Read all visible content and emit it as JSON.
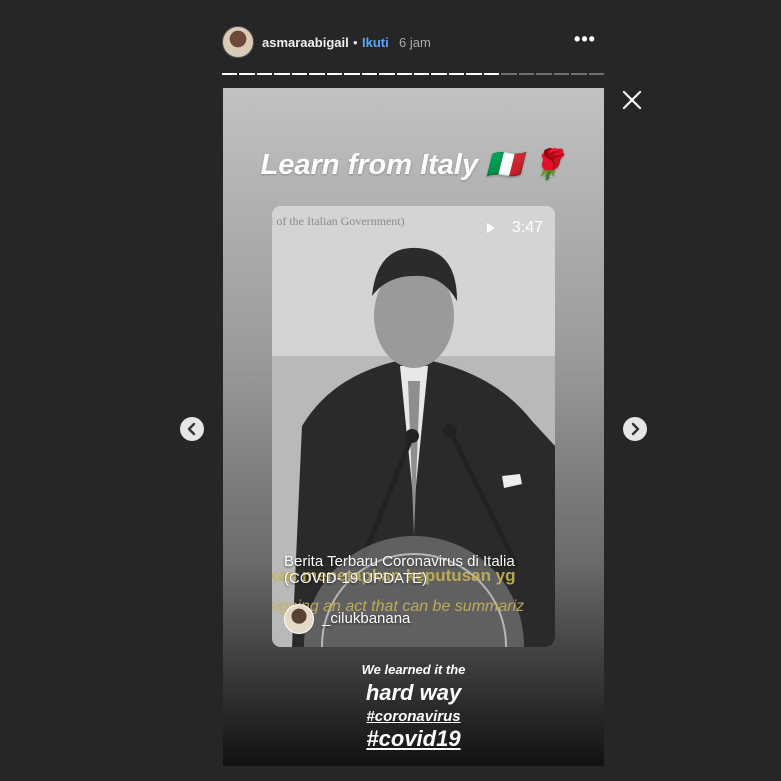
{
  "header": {
    "username": "asmaraabigail",
    "separator": "•",
    "follow_label": "Ikuti",
    "time": "6 jam",
    "more_label": "•••"
  },
  "progress": {
    "segments_total": 22,
    "segments_done": 16
  },
  "story": {
    "title": "Learn from Italy 🇮🇹 🌹",
    "video": {
      "top_caption": "l of the Italian Government)",
      "duration": "3:47",
      "title": "Berita Terbaru Coronavirus di Italia (COVID-19 UPDATE)",
      "subtitle_line1": "kan menetapkan keputusan yg",
      "subtitle_line2": "signing an act that can be summariz",
      "author": "_cilukbanana"
    },
    "text_line1": "We learned it the",
    "text_line2": "hard way",
    "text_line3": "#coronavirus",
    "text_line4": "#covid19"
  },
  "colors": {
    "background": "#262626",
    "follow": "#58a6f5"
  }
}
